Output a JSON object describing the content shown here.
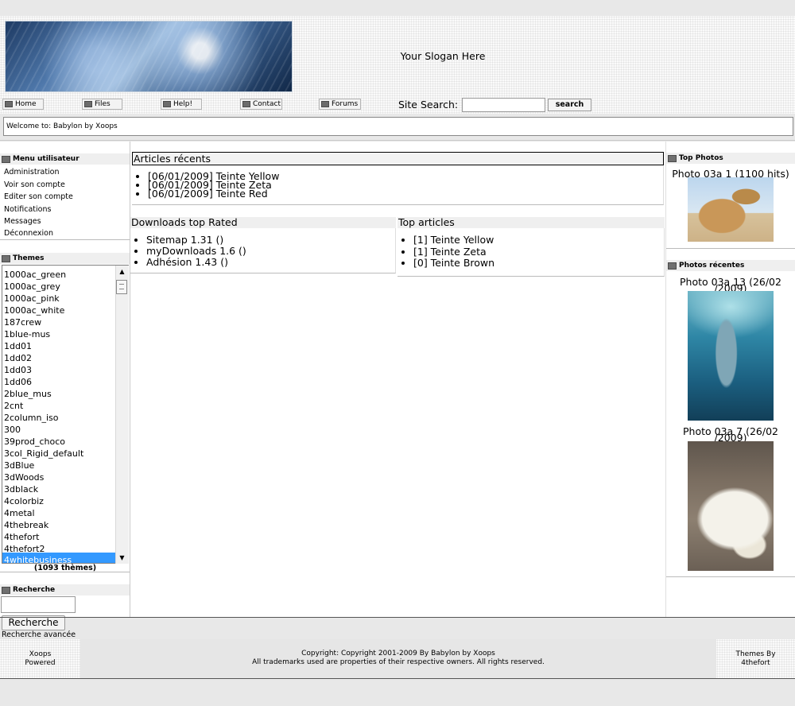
{
  "header": {
    "slogan": "Your Slogan Here",
    "nav": [
      "Home",
      "Files",
      "Help!",
      "Contact",
      "Forums"
    ],
    "search_label": "Site Search:",
    "search_value": "",
    "search_button": "search"
  },
  "welcome": "Welcome to: Babylon by Xoops",
  "user_menu": {
    "title": "Menu utilisateur",
    "items": [
      "Administration",
      "Voir son compte",
      "Editer son compte",
      "Notifications",
      "Messages",
      "Déconnexion"
    ]
  },
  "themes": {
    "title": "Themes",
    "items": [
      "1000ac_green",
      "1000ac_grey",
      "1000ac_pink",
      "1000ac_white",
      "187crew",
      "1blue-mus",
      "1dd01",
      "1dd02",
      "1dd03",
      "1dd06",
      "2blue_mus",
      "2cnt",
      "2column_iso",
      "300",
      "39prod_choco",
      "3col_Rigid_default",
      "3dBlue",
      "3dWoods",
      "3dblack",
      "4colorbiz",
      "4metal",
      "4thebreak",
      "4thefort",
      "4thefort2",
      "4whitebusiness"
    ],
    "selected": "4whitebusiness",
    "count": "(1093 thèmes)"
  },
  "recherche": {
    "title": "Recherche",
    "button": "Recherche",
    "advanced": "Recherche avancée"
  },
  "articles_recents": {
    "title": "Articles récents",
    "items": [
      "[06/01/2009] Teinte Yellow",
      "[06/01/2009] Teinte Zeta",
      "[06/01/2009] Teinte Red"
    ]
  },
  "downloads": {
    "title": "Downloads top Rated",
    "items": [
      "Sitemap 1.31 ()",
      "myDownloads 1.6 ()",
      "Adhésion 1.43 ()"
    ]
  },
  "top_articles": {
    "title": "Top articles",
    "items": [
      "[1] Teinte Yellow",
      "[1] Teinte Zeta",
      "[0] Teinte Brown"
    ]
  },
  "top_photos": {
    "title": "Top Photos",
    "caption": "Photo 03a 1 (1100 hits)"
  },
  "recent_photos": {
    "title": "Photos récentes",
    "items": [
      {
        "caption_line1": "Photo 03a 13 (26/02",
        "caption_line2": "/2009)"
      },
      {
        "caption_line1": "Photo 03a 7 (26/02",
        "caption_line2": "/2009)"
      }
    ]
  },
  "footer": {
    "left_line1": "Xoops",
    "left_line2": "Powered",
    "center_line1": "Copyright: Copyright 2001-2009 By Babylon by Xoops",
    "center_line2": "All trademarks used are properties of their respective owners. All rights reserved.",
    "right_line1": "Themes By",
    "right_line2": "4thefort"
  }
}
